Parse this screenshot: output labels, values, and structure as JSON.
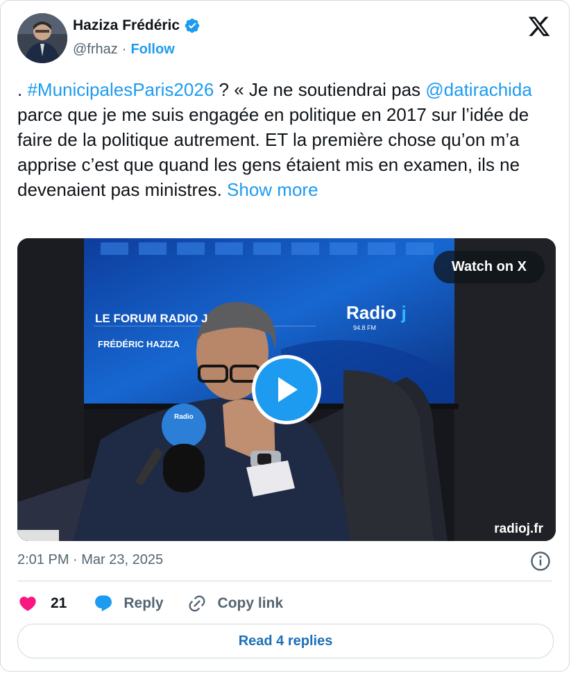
{
  "author": {
    "name": "Haziza Frédéric",
    "handle": "@frhaz",
    "separator": "·",
    "follow_label": "Follow"
  },
  "tweet": {
    "prefix": ". ",
    "hashtag": "#MunicipalesParis2026",
    "part1": " ? « Je ne soutiendrai pas ",
    "mention": "@datirachida",
    "part2": " parce que je me suis engagée en politique en 2017 sur l’idée de faire de la politique autrement. ET la première chose qu’on m’a apprise c’est que quand les gens étaient mis en examen, ils ne devenaient pas ministres. ",
    "show_more": "Show more"
  },
  "media": {
    "watch_label": "Watch on X",
    "screen_title": "LE FORUM RADIO J",
    "screen_subtitle": "FRÉDÉRIC HAZIZA",
    "logo_text": "Radio",
    "logo_freq": "94.8 FM",
    "watermark": "radioj.fr"
  },
  "meta": {
    "timestamp": "2:01 PM · Mar 23, 2025"
  },
  "actions": {
    "like_count": "21",
    "reply_label": "Reply",
    "copy_label": "Copy link"
  },
  "footer": {
    "read_replies": "Read 4 replies"
  },
  "colors": {
    "accent": "#1d9bf0",
    "like": "#f91880",
    "text": "#0f1419",
    "muted": "#536471"
  }
}
